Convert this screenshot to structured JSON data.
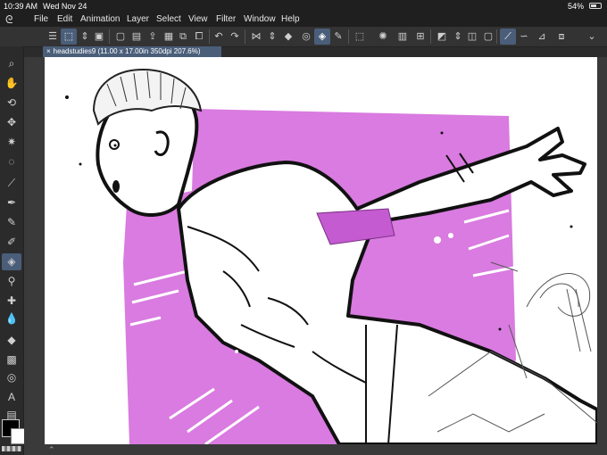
{
  "status": {
    "time": "10:39 AM",
    "date": "Wed Nov 24",
    "battery": "54%"
  },
  "menu": [
    "File",
    "Edit",
    "Animation",
    "Layer",
    "Select",
    "View",
    "Filter",
    "Window",
    "Help"
  ],
  "document_tab": {
    "close": "×",
    "title": "headstudies9 (11.00 x 17.00in 350dpi 207.6%)"
  },
  "colors": {
    "accent": "#4a5e7a",
    "backdrop": "#d97be0"
  },
  "left_tools": [
    "search-icon",
    "hand-icon",
    "rotate-icon",
    "move-icon",
    "wand-icon",
    "lasso-icon",
    "eyedropper-icon",
    "pen-icon",
    "pencil-icon",
    "brush-icon",
    "eraser-icon",
    "blend-icon",
    "decoration-icon",
    "fill-icon",
    "gradient-icon",
    "figure-icon",
    "text-icon",
    "frame-icon"
  ]
}
